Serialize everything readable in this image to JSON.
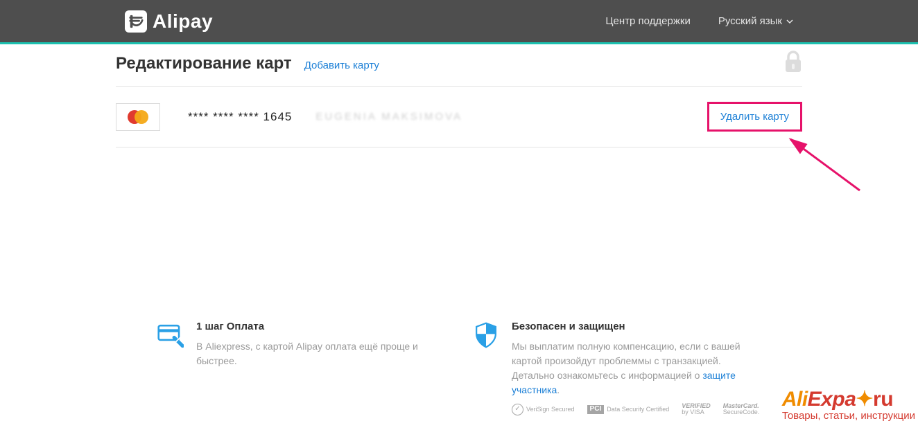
{
  "header": {
    "brand": "Alipay",
    "support": "Центр поддержки",
    "language": "Русский язык"
  },
  "page": {
    "title": "Редактирование карт",
    "add_card": "Добавить карту"
  },
  "card": {
    "number": "**** **** **** 1645",
    "holder": "EUGENIA MAKSIMOVA",
    "delete": "Удалить карту"
  },
  "info": {
    "pay": {
      "title": "1 шаг Оплата",
      "text": "В Aliexpress, с картой Alipay оплата ещё проще и быстрее."
    },
    "secure": {
      "title": "Безопасен и защищен",
      "text": "Мы выплатим полную компенсацию, если с вашей картой произойдут проблеммы с транзакцией. Детально ознакомьтесь с информацией о ",
      "link": "защите участника",
      "badges": {
        "verisign": "VeriSign Secured",
        "pci": "PCI",
        "pci_sub": "Data Security Certified",
        "vbv_top": "VERIFIED",
        "vbv_sub": "by VISA",
        "msc_top": "MasterCard.",
        "msc_sub": "SecureCode."
      }
    }
  },
  "watermark": {
    "ali": "Ali",
    "expa": "Expa",
    "ru": "ru",
    "sub": "Товары, статьи, инструкции"
  }
}
